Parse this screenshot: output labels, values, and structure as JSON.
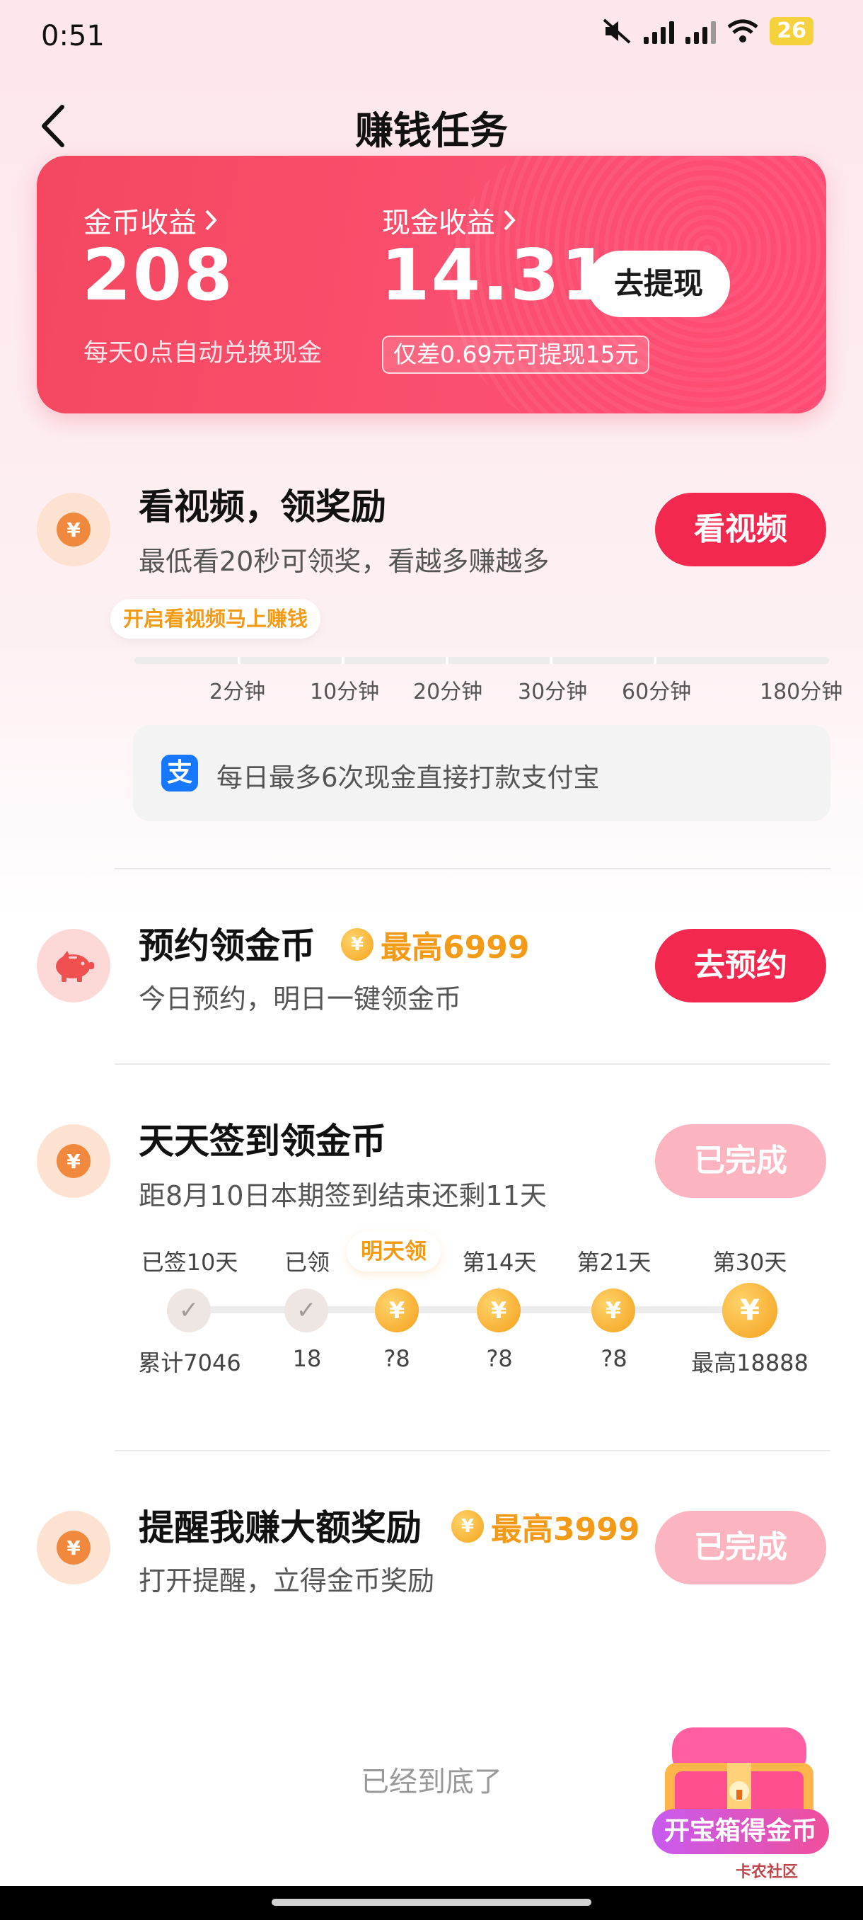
{
  "status_bar": {
    "time": "0:51",
    "battery": "26"
  },
  "header": {
    "title": "赚钱任务"
  },
  "earnings": {
    "coin_label": "金币收益",
    "coin_value": "208",
    "coin_note": "每天0点自动兑换现金",
    "cash_label": "现金收益",
    "cash_value": "14.31",
    "withdraw_button": "去提现",
    "gap_tip": "仅差0.69元可提现15元"
  },
  "tasks": {
    "video": {
      "title": "看视频，领奖励",
      "desc": "最低看20秒可领奖，看越多赚越多",
      "button": "看视频",
      "tip": "开启看视频马上赚钱",
      "milestones": [
        "2分钟",
        "10分钟",
        "20分钟",
        "30分钟",
        "60分钟",
        "180分钟"
      ],
      "alipay_note": "每日最多6次现金直接打款支付宝",
      "alipay_glyph": "支"
    },
    "reserve": {
      "title": "预约领金币",
      "badge": "最高6999",
      "desc": "今日预约，明日一键领金币",
      "button": "去预约"
    },
    "signin": {
      "title": "天天签到领金币",
      "desc": "距8月10日本期签到结束还剩11天",
      "button": "已完成",
      "tomorrow_tag": "明天领",
      "days": [
        {
          "top": "已签10天",
          "bottom": "累计7046",
          "state": "done"
        },
        {
          "top": "已领",
          "bottom": "18",
          "state": "done"
        },
        {
          "top": "",
          "bottom": "?8",
          "state": "coin"
        },
        {
          "top": "第14天",
          "bottom": "?8",
          "state": "coin"
        },
        {
          "top": "第21天",
          "bottom": "?8",
          "state": "coin"
        },
        {
          "top": "第30天",
          "bottom": "最高18888",
          "state": "big"
        }
      ]
    },
    "remind": {
      "title": "提醒我赚大额奖励",
      "badge": "最高3999",
      "desc": "打开提醒，立得金币奖励",
      "button": "已完成"
    }
  },
  "footer": {
    "end_text": "已经到底了",
    "treasure_label": "开宝箱得金币",
    "watermark": "卡农社区"
  },
  "icons": {
    "coin_glyph": "¥",
    "check_glyph": "✓"
  },
  "colors": {
    "primary": "#f3284f",
    "gold": "#f39a16",
    "done_button": "#fdb4c1"
  }
}
